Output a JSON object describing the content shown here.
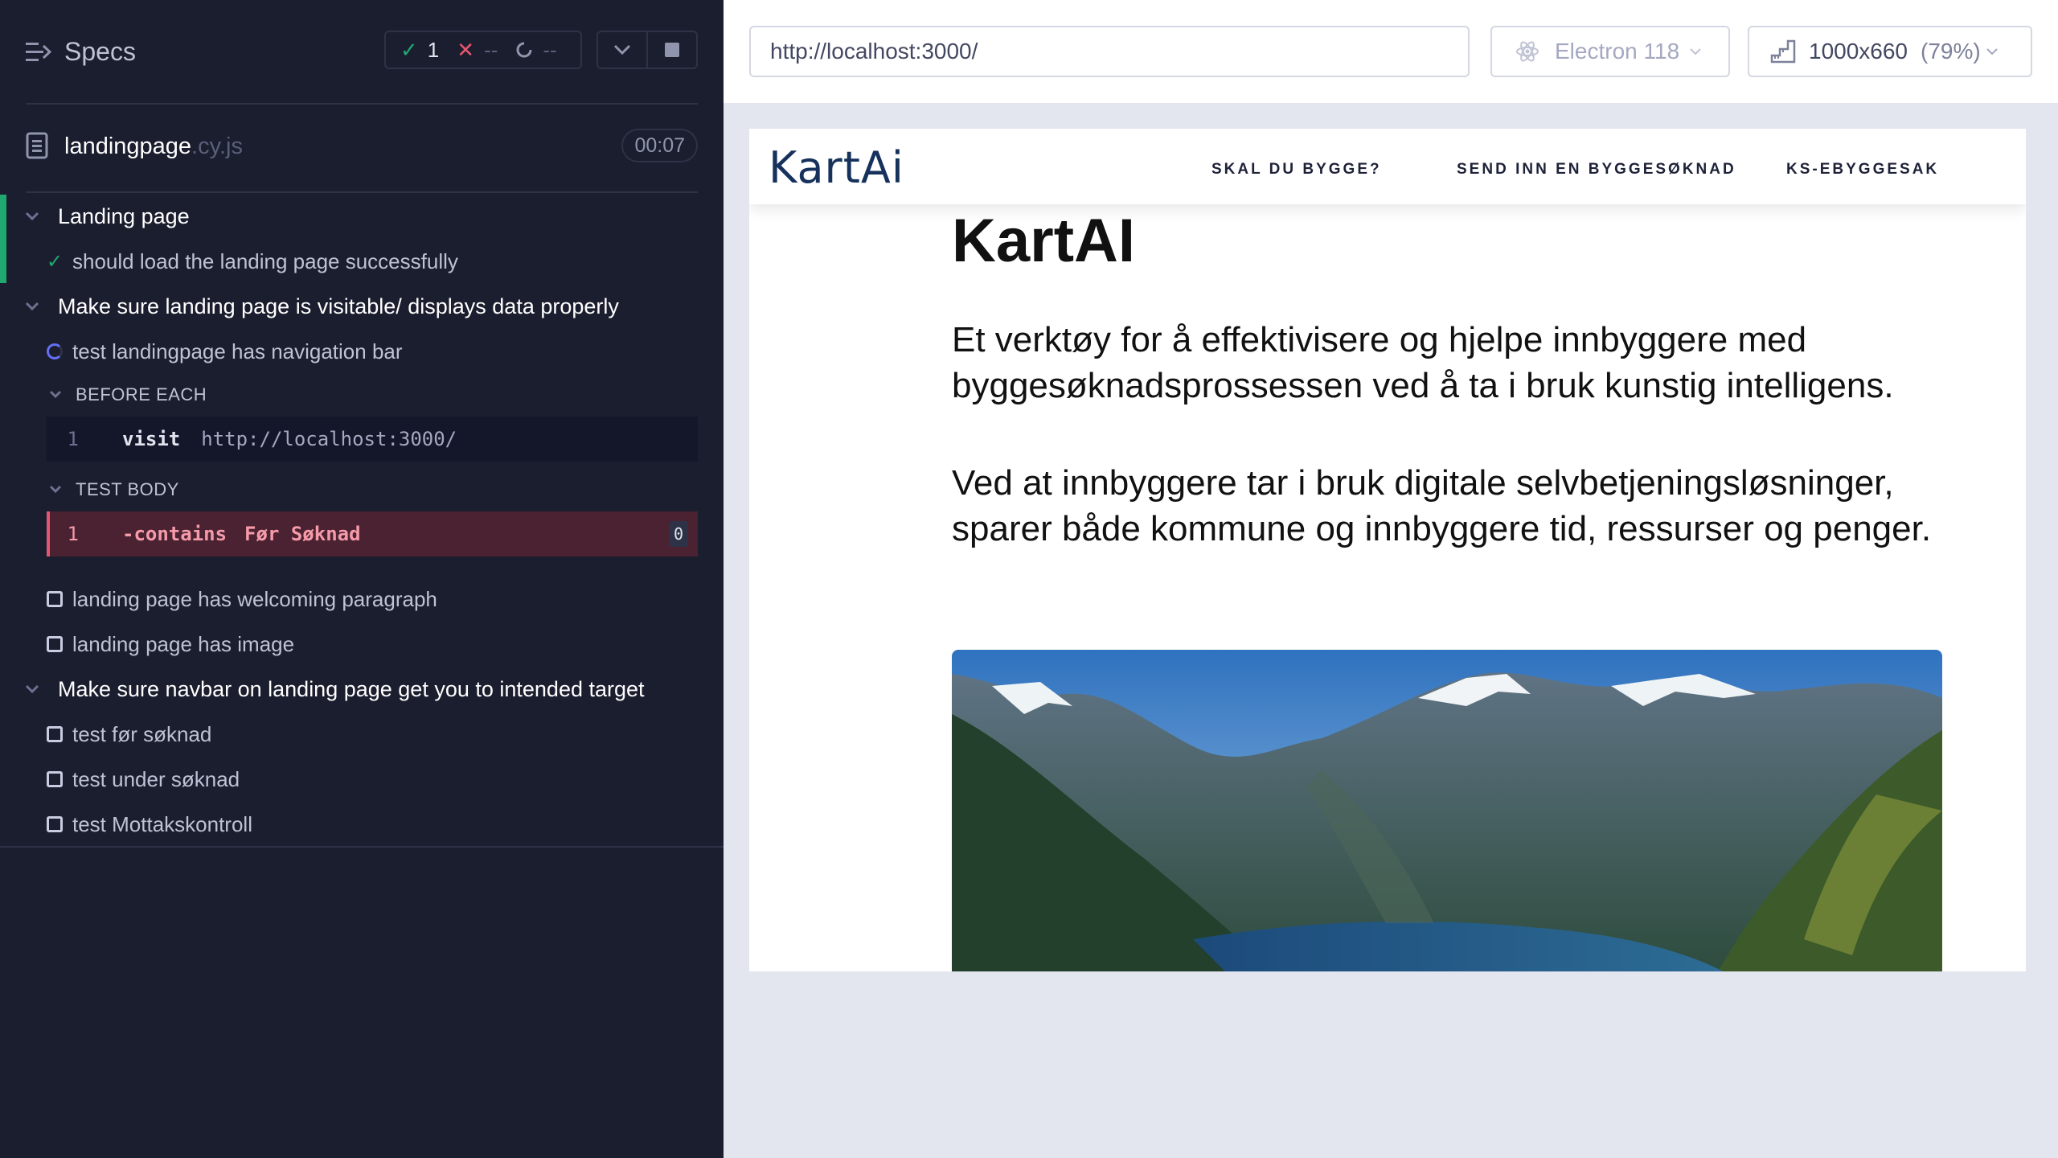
{
  "reporter": {
    "header": {
      "title": "Specs",
      "passed_count": "1",
      "failed_count": "--",
      "pending_count": "--"
    },
    "file": {
      "name": "landingpage",
      "ext": ".cy.js",
      "duration": "00:07"
    },
    "suites": [
      {
        "title": "Landing page",
        "tests": [
          {
            "title": "should load the landing page successfully",
            "state": "passed"
          }
        ]
      },
      {
        "title": "Make sure landing page is visitable/ displays data properly",
        "tests": [
          {
            "title": "test landingpage has navigation bar",
            "state": "running"
          },
          {
            "title": "landing page has welcoming paragraph",
            "state": "pending"
          },
          {
            "title": "landing page has image",
            "state": "pending"
          }
        ]
      },
      {
        "title": "Make sure navbar on landing page get you to intended target",
        "tests": [
          {
            "title": "test før søknad",
            "state": "pending"
          },
          {
            "title": "test under søknad",
            "state": "pending"
          },
          {
            "title": "test Mottakskontroll",
            "state": "pending"
          }
        ]
      }
    ],
    "hooks": {
      "before_each": {
        "label": "BEFORE EACH",
        "command": {
          "num": "1",
          "name": "visit",
          "arg": "http://localhost:3000/"
        }
      },
      "test_body": {
        "label": "TEST BODY",
        "command": {
          "num": "1",
          "name": "-contains",
          "arg": "Før Søknad",
          "badge": "0"
        }
      }
    }
  },
  "aut": {
    "url": "http://localhost:3000/",
    "browser": "Electron 118",
    "viewport": "1000x660",
    "zoom": "(79%)"
  },
  "site": {
    "logo": "KartAi",
    "nav": [
      "SKAL DU BYGGE?",
      "SEND INN EN BYGGESØKNAD",
      "KS-EBYGGESAK"
    ],
    "heading": "KartAI",
    "paragraph1": "Et verktøy for å effektivisere og hjelpe innbyggere med byggesøknadsprossessen ved å ta i bruk kunstig intelligens.",
    "paragraph2": "Ved at innbyggere tar i bruk digitale selvbetjeningsløsninger, sparer både kommune og innbyggere tid, ressurser og penger."
  },
  "colors": {
    "reporter_bg": "#1b1e2e",
    "pass": "#1fa971",
    "fail": "#e45770",
    "running": "#6470f3",
    "brand_navy": "#16325c"
  },
  "icons": {
    "specs": "list-arrow-icon",
    "pass": "check-icon",
    "fail": "x-icon",
    "pending": "spinner-icon",
    "file": "document-icon",
    "browser": "electron-icon",
    "viewport": "ruler-icon"
  }
}
